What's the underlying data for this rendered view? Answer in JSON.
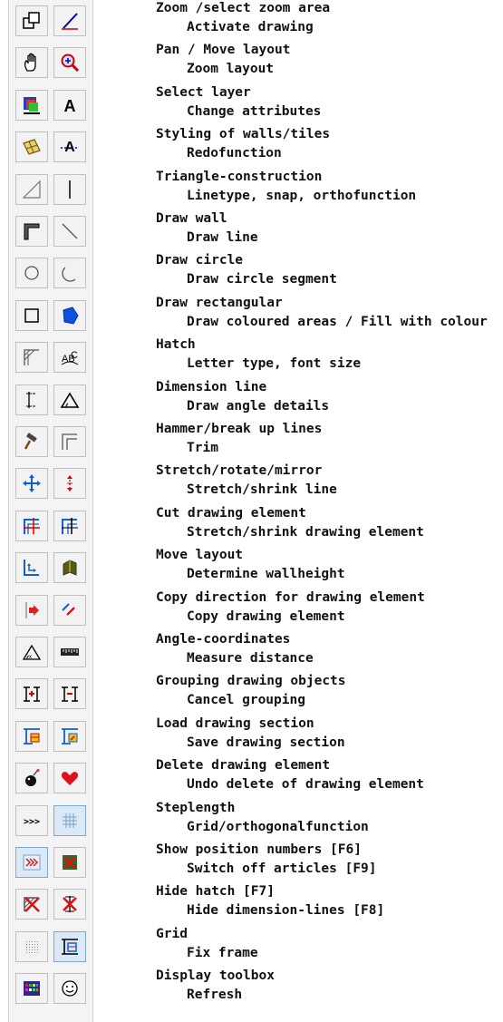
{
  "tools": [
    {
      "left": {
        "icon": "zoom-area-icon"
      },
      "right": {
        "icon": "activate-drawing-icon"
      },
      "left_label": "Zoom /select zoom area",
      "right_label": "Activate drawing"
    },
    {
      "left": {
        "icon": "pan-hand-icon"
      },
      "right": {
        "icon": "zoom-magnifier-icon"
      },
      "left_label": "Pan / Move layout",
      "right_label": "Zoom layout"
    },
    {
      "left": {
        "icon": "select-layer-icon"
      },
      "right": {
        "icon": "change-attributes-icon"
      },
      "left_label": "Select layer",
      "right_label": "Change attributes"
    },
    {
      "left": {
        "icon": "wall-tiles-icon"
      },
      "right": {
        "icon": "redo-function-icon"
      },
      "left_label": "Styling of walls/tiles",
      "right_label": "Redofunction"
    },
    {
      "left": {
        "icon": "triangle-construction-icon"
      },
      "right": {
        "icon": "linetype-icon"
      },
      "left_label": "Triangle-construction",
      "right_label": "Linetype, snap, orthofunction"
    },
    {
      "left": {
        "icon": "draw-wall-icon"
      },
      "right": {
        "icon": "draw-line-icon"
      },
      "left_label": "Draw wall",
      "right_label": "Draw line"
    },
    {
      "left": {
        "icon": "draw-circle-icon"
      },
      "right": {
        "icon": "circle-segment-icon"
      },
      "left_label": "Draw circle",
      "right_label": "Draw circle segment"
    },
    {
      "left": {
        "icon": "draw-rectangle-icon"
      },
      "right": {
        "icon": "fill-colour-icon"
      },
      "left_label": "Draw rectangular",
      "right_label": "Draw coloured areas / Fill with colour"
    },
    {
      "left": {
        "icon": "hatch-icon"
      },
      "right": {
        "icon": "letter-type-icon"
      },
      "left_label": "Hatch",
      "right_label": "Letter type, font size"
    },
    {
      "left": {
        "icon": "dimension-line-icon"
      },
      "right": {
        "icon": "angle-details-icon"
      },
      "left_label": "Dimension line",
      "right_label": "Draw angle details"
    },
    {
      "left": {
        "icon": "hammer-icon"
      },
      "right": {
        "icon": "trim-icon"
      },
      "left_label": "Hammer/break up lines",
      "right_label": "Trim"
    },
    {
      "left": {
        "icon": "stretch-rotate-mirror-icon"
      },
      "right": {
        "icon": "stretch-line-icon"
      },
      "left_label": "Stretch/rotate/mirror",
      "right_label": "Stretch/shrink line"
    },
    {
      "left": {
        "icon": "cut-element-icon"
      },
      "right": {
        "icon": "stretch-element-icon"
      },
      "left_label": "Cut drawing element",
      "right_label": "Stretch/shrink drawing element"
    },
    {
      "left": {
        "icon": "move-layout-icon"
      },
      "right": {
        "icon": "wall-height-icon"
      },
      "left_label": "Move layout",
      "right_label": "Determine wallheight"
    },
    {
      "left": {
        "icon": "copy-direction-icon"
      },
      "right": {
        "icon": "copy-element-icon"
      },
      "left_label": "Copy direction for drawing element",
      "right_label": "Copy drawing element"
    },
    {
      "left": {
        "icon": "angle-coordinates-icon"
      },
      "right": {
        "icon": "measure-ruler-icon"
      },
      "left_label": "Angle-coordinates",
      "right_label": "Measure distance"
    },
    {
      "left": {
        "icon": "group-objects-icon"
      },
      "right": {
        "icon": "ungroup-objects-icon"
      },
      "left_label": "Grouping drawing objects",
      "right_label": "Cancel grouping"
    },
    {
      "left": {
        "icon": "load-section-icon"
      },
      "right": {
        "icon": "save-section-icon"
      },
      "left_label": "Load drawing section",
      "right_label": "Save drawing section"
    },
    {
      "left": {
        "icon": "bomb-delete-icon"
      },
      "right": {
        "icon": "heart-undo-icon"
      },
      "left_label": "Delete drawing element",
      "right_label": "Undo delete of drawing element"
    },
    {
      "left": {
        "icon": "steplength-arrows-icon"
      },
      "right": {
        "icon": "grid-ortho-icon",
        "active": true
      },
      "left_label": "Steplength",
      "right_label": "Grid/orthogonalfunction"
    },
    {
      "left": {
        "icon": "position-numbers-icon",
        "active": true
      },
      "right": {
        "icon": "articles-off-icon"
      },
      "left_label": "Show position numbers [F6]",
      "right_label": "Switch off articles [F9]"
    },
    {
      "left": {
        "icon": "hide-hatch-icon"
      },
      "right": {
        "icon": "hide-dimension-icon"
      },
      "left_label": "Hide hatch [F7]",
      "right_label": "Hide dimension-lines [F8]"
    },
    {
      "left": {
        "icon": "grid-dots-icon"
      },
      "right": {
        "icon": "fix-frame-icon",
        "active": true
      },
      "left_label": "Grid",
      "right_label": "Fix frame"
    },
    {
      "left": {
        "icon": "display-toolbox-icon"
      },
      "right": {
        "icon": "smiley-refresh-icon"
      },
      "left_label": "Display toolbox",
      "right_label": "Refresh"
    }
  ],
  "colors": {
    "toolbar_bg": "#f4f4f4",
    "button_border": "#bfbfbf",
    "active_bg": "#dbe9f7",
    "text": "#111111"
  }
}
